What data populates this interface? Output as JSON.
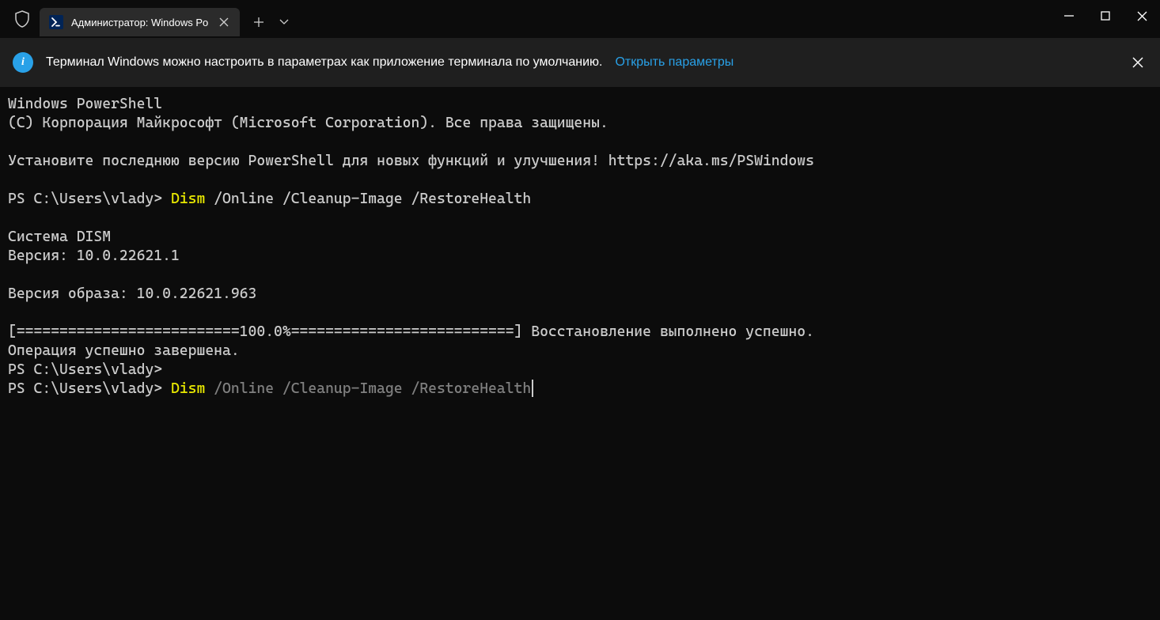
{
  "tab": {
    "title": "Администратор: Windows Po"
  },
  "infobar": {
    "text": "Терминал Windows можно настроить в параметрах как приложение терминала по умолчанию.",
    "link": "Открыть параметры"
  },
  "terminal": {
    "line1": "Windows PowerShell",
    "line2": "(C) Корпорация Майкрософт (Microsoft Corporation). Все права защищены.",
    "line3": "",
    "line4": "Установите последнюю версию PowerShell для новых функций и улучшения! https://aka.ms/PSWindows",
    "line5": "",
    "prompt1": "PS C:\\Users\\vlady> ",
    "cmd1_yellow": "Dism",
    "cmd1_rest": " /Online /Cleanup-Image /RestoreHealth",
    "line7": "",
    "line8": "Cистема DISM",
    "line9": "Версия: 10.0.22621.1",
    "line10": "",
    "line11": "Версия образа: 10.0.22621.963",
    "line12": "",
    "line13": "[==========================100.0%==========================] Восстановление выполнено успешно.",
    "line14": "Операция успешно завершена.",
    "prompt2": "PS C:\\Users\\vlady>",
    "prompt3": "PS C:\\Users\\vlady> ",
    "cmd3_yellow": "Dism",
    "cmd3_gray": " /Online /Cleanup-Image /RestoreHealth"
  }
}
